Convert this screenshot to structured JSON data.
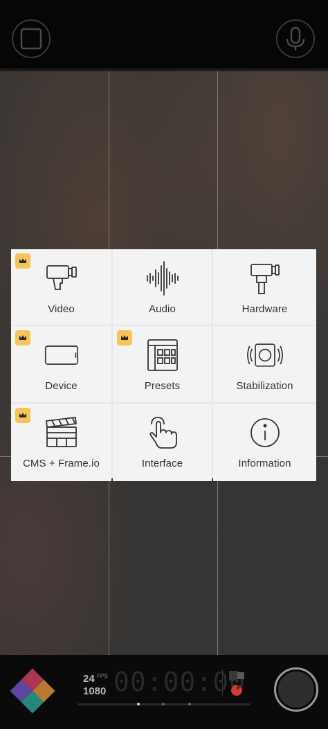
{
  "topbar": {
    "left_button_icon": "square-frame-icon",
    "right_button_icon": "microphone-icon"
  },
  "menu": {
    "items": [
      {
        "label": "Video",
        "icon": "video-camera-icon",
        "premium": true
      },
      {
        "label": "Audio",
        "icon": "audio-waveform-icon",
        "premium": false
      },
      {
        "label": "Hardware",
        "icon": "hardware-camera-icon",
        "premium": false
      },
      {
        "label": "Device",
        "icon": "phone-landscape-icon",
        "premium": true
      },
      {
        "label": "Presets",
        "icon": "presets-grid-icon",
        "premium": true
      },
      {
        "label": "Stabilization",
        "icon": "stabilization-icon",
        "premium": false
      },
      {
        "label": "CMS + Frame.io",
        "icon": "clapperboard-icon",
        "premium": true
      },
      {
        "label": "Interface",
        "icon": "touch-hand-icon",
        "premium": false
      },
      {
        "label": "Information",
        "icon": "info-icon",
        "premium": false
      }
    ],
    "premium_badge_icon": "crown-icon",
    "badge_color": "#f5c55a"
  },
  "recording": {
    "fps": "24",
    "fps_unit": "FPS",
    "resolution": "1080",
    "timecode": "00:00:00",
    "record_color": "#d23a3a"
  },
  "logo": {
    "colors": [
      "#e0476a",
      "#f2a03d",
      "#7b5bd6",
      "#2fb3a4"
    ]
  }
}
